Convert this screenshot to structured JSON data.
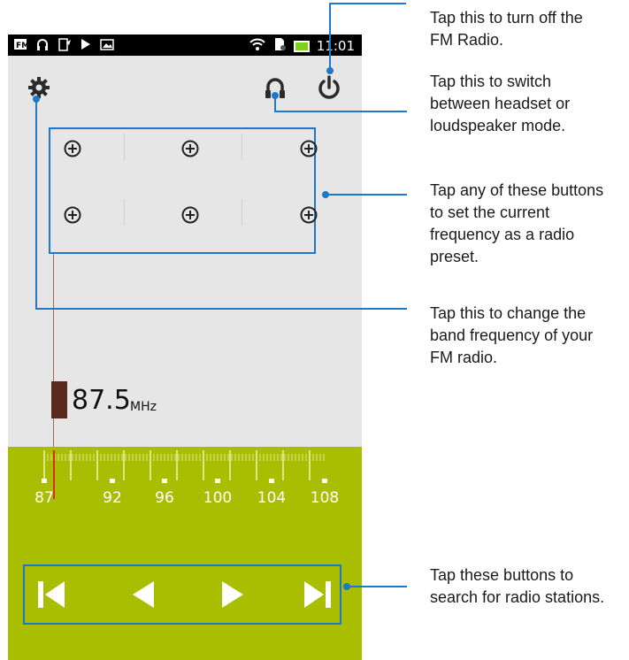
{
  "status_bar": {
    "left_icons": [
      "fm-radio-icon",
      "headset-icon",
      "battery-saver-icon",
      "play-icon",
      "gallery-icon"
    ],
    "right_icons": [
      "wifi-icon",
      "sim-icon",
      "battery-charging-icon"
    ],
    "time": "11:01"
  },
  "toolbar": {
    "settings_icon": "gear-icon",
    "headset_icon": "headset-icon",
    "power_icon": "power-icon"
  },
  "presets": {
    "buttons": [
      {
        "icon": "add-circle-icon"
      },
      {
        "icon": "add-circle-icon"
      },
      {
        "icon": "add-circle-icon"
      },
      {
        "icon": "add-circle-icon"
      },
      {
        "icon": "add-circle-icon"
      },
      {
        "icon": "add-circle-icon"
      }
    ]
  },
  "tuner": {
    "frequency": "87.5",
    "unit": "MHz",
    "scale_labels": [
      "87",
      "92",
      "96",
      "100",
      "104",
      "108"
    ],
    "current_position": 0.02
  },
  "controls": {
    "buttons": [
      {
        "icon": "skip-previous-icon"
      },
      {
        "icon": "seek-back-icon"
      },
      {
        "icon": "seek-forward-icon"
      },
      {
        "icon": "skip-next-icon"
      }
    ]
  },
  "callouts": {
    "power": "Tap this to turn off the\nFM Radio.",
    "headset": "Tap this to switch\nbetween headset or\nloudspeaker mode.",
    "presets": "Tap any of these buttons\nto set the current\nfrequency as a radio\npreset.",
    "band": "Tap this to change the\nband frequency of your\nFM radio.",
    "search": "Tap these buttons to\nsearch for radio stations."
  },
  "colors": {
    "accent_line": "#1e78c8",
    "green_panel": "#a9be00",
    "app_background": "#e6e6e6",
    "frequency_marker": "#5b2a1e"
  }
}
